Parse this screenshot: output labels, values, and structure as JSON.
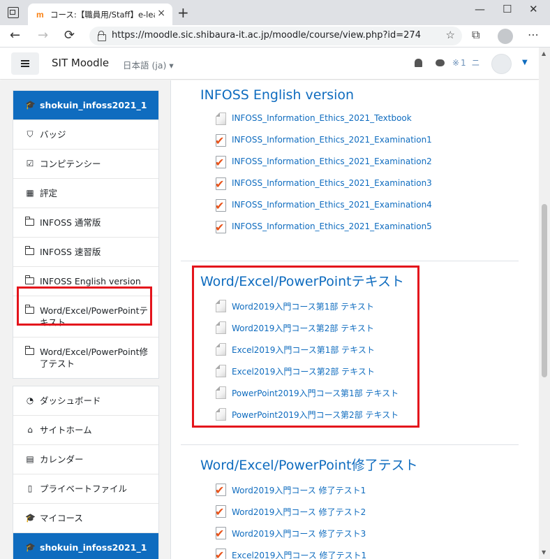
{
  "browser": {
    "tab_favicon": "m",
    "tab_title": "コース:【職員用/Staff】e-learning",
    "tab_close": "×",
    "new_tab": "+",
    "minimize": "—",
    "maximize": "☐",
    "close": "✕",
    "back": "←",
    "forward": "→",
    "reload": "⟳",
    "url": "https://moodle.sic.shibaura-it.ac.jp/moodle/course/view.php?id=274",
    "favorite_add": "☆",
    "collections": "⧉",
    "menu": "⋯"
  },
  "navbar": {
    "brand": "SIT Moodle",
    "language": "日本語 (ja) ▾",
    "username": "※1 ニ",
    "user_caret": "▼"
  },
  "sidebar": {
    "course_top": "shokuin_infoss2021_1",
    "badges": "バッジ",
    "competencies": "コンピテンシー",
    "grades": "評定",
    "sections": [
      "INFOSS 通常版",
      "INFOSS 速習版",
      "INFOSS English version",
      "Word/Excel/PowerPointテキスト",
      "Word/Excel/PowerPoint修了テスト"
    ],
    "dashboard": "ダッシュボード",
    "site_home": "サイトホーム",
    "calendar": "カレンダー",
    "private_files": "プライベートファイル",
    "my_courses": "マイコース",
    "course_bottom": "shokuin_infoss2021_1"
  },
  "content": {
    "sections": [
      {
        "title": "INFOSS English version",
        "activities": [
          {
            "label": "INFOSS_Information_Ethics_2021_Textbook",
            "type": "page"
          },
          {
            "label": "INFOSS_Information_Ethics_2021_Examination1",
            "type": "quiz"
          },
          {
            "label": "INFOSS_Information_Ethics_2021_Examination2",
            "type": "quiz"
          },
          {
            "label": "INFOSS_Information_Ethics_2021_Examination3",
            "type": "quiz"
          },
          {
            "label": "INFOSS_Information_Ethics_2021_Examination4",
            "type": "quiz"
          },
          {
            "label": "INFOSS_Information_Ethics_2021_Examination5",
            "type": "quiz"
          }
        ]
      },
      {
        "title": "Word/Excel/PowerPointテキスト",
        "activities": [
          {
            "label": "Word2019入門コース第1部 テキスト",
            "type": "page"
          },
          {
            "label": "Word2019入門コース第2部 テキスト",
            "type": "page"
          },
          {
            "label": "Excel2019入門コース第1部 テキスト",
            "type": "page"
          },
          {
            "label": "Excel2019入門コース第2部 テキスト",
            "type": "page"
          },
          {
            "label": "PowerPoint2019入門コース第1部 テキスト",
            "type": "page"
          },
          {
            "label": "PowerPoint2019入門コース第2部 テキスト",
            "type": "page"
          }
        ]
      },
      {
        "title": "Word/Excel/PowerPoint修了テスト",
        "activities": [
          {
            "label": "Word2019入門コース 修了テスト1",
            "type": "quiz"
          },
          {
            "label": "Word2019入門コース 修了テスト2",
            "type": "quiz"
          },
          {
            "label": "Word2019入門コース 修了テスト3",
            "type": "quiz"
          },
          {
            "label": "Excel2019入門コース 修了テスト1",
            "type": "quiz"
          }
        ]
      }
    ]
  },
  "colors": {
    "brand_blue": "#0f6cbf",
    "highlight_red": "#e4141c",
    "quiz_check": "#e8531a"
  },
  "icons": {
    "badges": "shield-icon",
    "competencies": "checkbox-icon",
    "grades": "table-icon",
    "section": "folder-icon",
    "dashboard": "tachometer-icon",
    "site_home": "home-icon",
    "calendar": "calendar-icon",
    "private_files": "file-icon",
    "my_courses": "graduation-cap-icon"
  }
}
